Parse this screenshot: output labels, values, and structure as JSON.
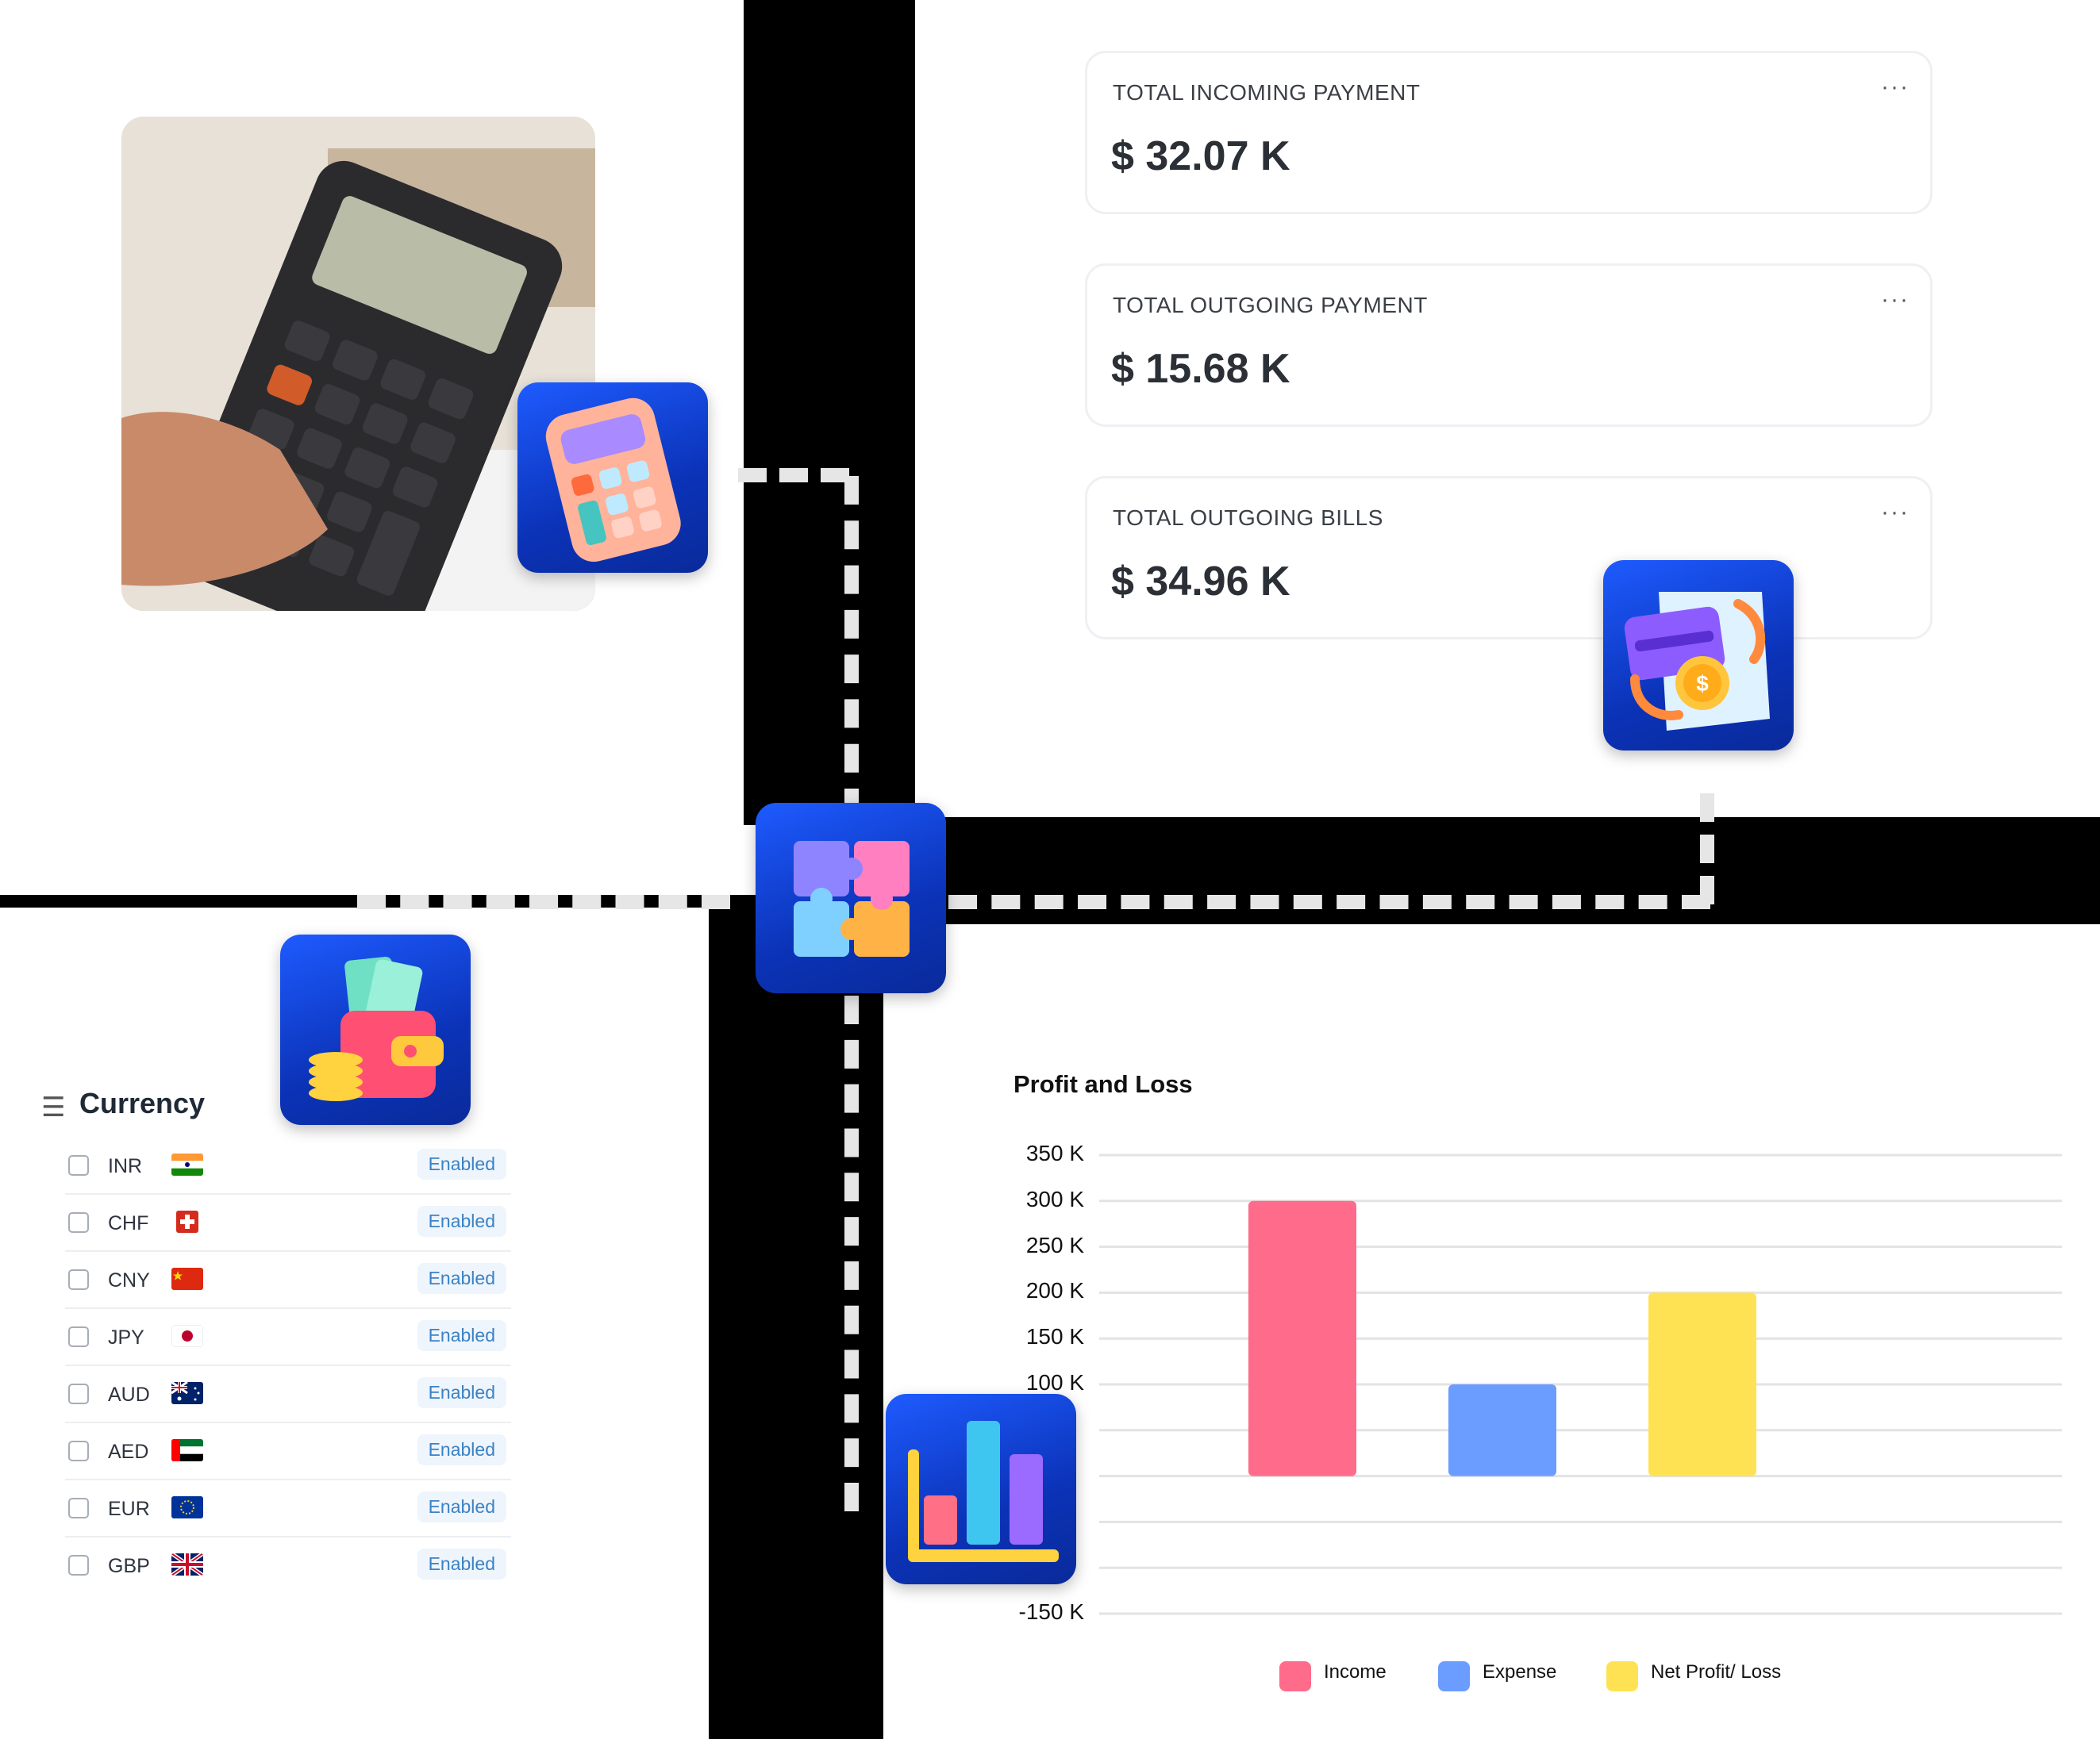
{
  "stats": [
    {
      "label": "TOTAL INCOMING PAYMENT",
      "value": "$ 32.07 K"
    },
    {
      "label": "TOTAL OUTGOING PAYMENT",
      "value": "$ 15.68 K"
    },
    {
      "label": "TOTAL OUTGOING BILLS",
      "value": "$ 34.96 K"
    }
  ],
  "more_label": "···",
  "currency": {
    "title": "Currency",
    "menu_icon": "☰",
    "rows": [
      {
        "code": "INR",
        "status": "Enabled"
      },
      {
        "code": "CHF",
        "status": "Enabled"
      },
      {
        "code": "CNY",
        "status": "Enabled"
      },
      {
        "code": "JPY",
        "status": "Enabled"
      },
      {
        "code": "AUD",
        "status": "Enabled"
      },
      {
        "code": "AED",
        "status": "Enabled"
      },
      {
        "code": "EUR",
        "status": "Enabled"
      },
      {
        "code": "GBP",
        "status": "Enabled"
      }
    ]
  },
  "icons": [
    "calculator-icon",
    "payment-exchange-icon",
    "puzzle-icon",
    "wallet-icon",
    "bar-chart-icon"
  ],
  "chart_data": {
    "type": "bar",
    "title": "Profit and Loss",
    "categories": [
      "Income",
      "Expense",
      "Net Profit/ Loss"
    ],
    "values": [
      300,
      100,
      200
    ],
    "ylim": [
      -150,
      350
    ],
    "yticks": [
      "350 K",
      "300 K",
      "250 K",
      "200 K",
      "150 K",
      "100 K",
      "-150 K"
    ],
    "colors": [
      "#ff6b8a",
      "#6b9cff",
      "#ffe254"
    ],
    "legend": [
      "Income",
      "Expense",
      "Net Profit/ Loss"
    ],
    "grid": true,
    "legend_position": "bottom"
  }
}
